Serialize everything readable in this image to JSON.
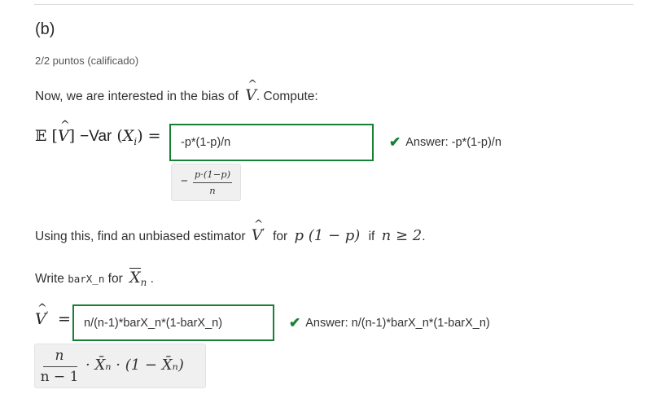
{
  "part": {
    "label": "(b)",
    "points": "2/2 puntos (calificado)"
  },
  "q1": {
    "prompt_pre": "Now, we are interested in the bias of",
    "prompt_post": ". Compute:",
    "lhs": "E[V̂] − Var(Xᵢ) =",
    "input_value": "-p*(1-p)/n",
    "answer_text": "Answer: -p*(1-p)/n",
    "preview": {
      "minus": "−",
      "numerator": "p·(1−p)",
      "denominator": "n"
    }
  },
  "q2": {
    "text_pre": "Using this, find an unbiased estimator",
    "text_mid": "for",
    "expr": "p (1 − p)",
    "text_if": "if",
    "condition": "n ≥ 2",
    "condition_end": "."
  },
  "hint": {
    "pre": "Write",
    "code": "barX_n",
    "mid": "for",
    "end": "."
  },
  "q3": {
    "lhs": "=",
    "input_value": "n/(n-1)*barX_n*(1-barX_n)",
    "answer_text": "Answer: n/(n-1)*barX_n*(1-barX_n)",
    "preview": {
      "numerator": "n",
      "denominator": "n − 1",
      "rest": "· X̄ₙ · (1 − X̄ₙ)"
    }
  },
  "colors": {
    "correct": "#178036",
    "preview_bg": "#f0f0f0"
  }
}
